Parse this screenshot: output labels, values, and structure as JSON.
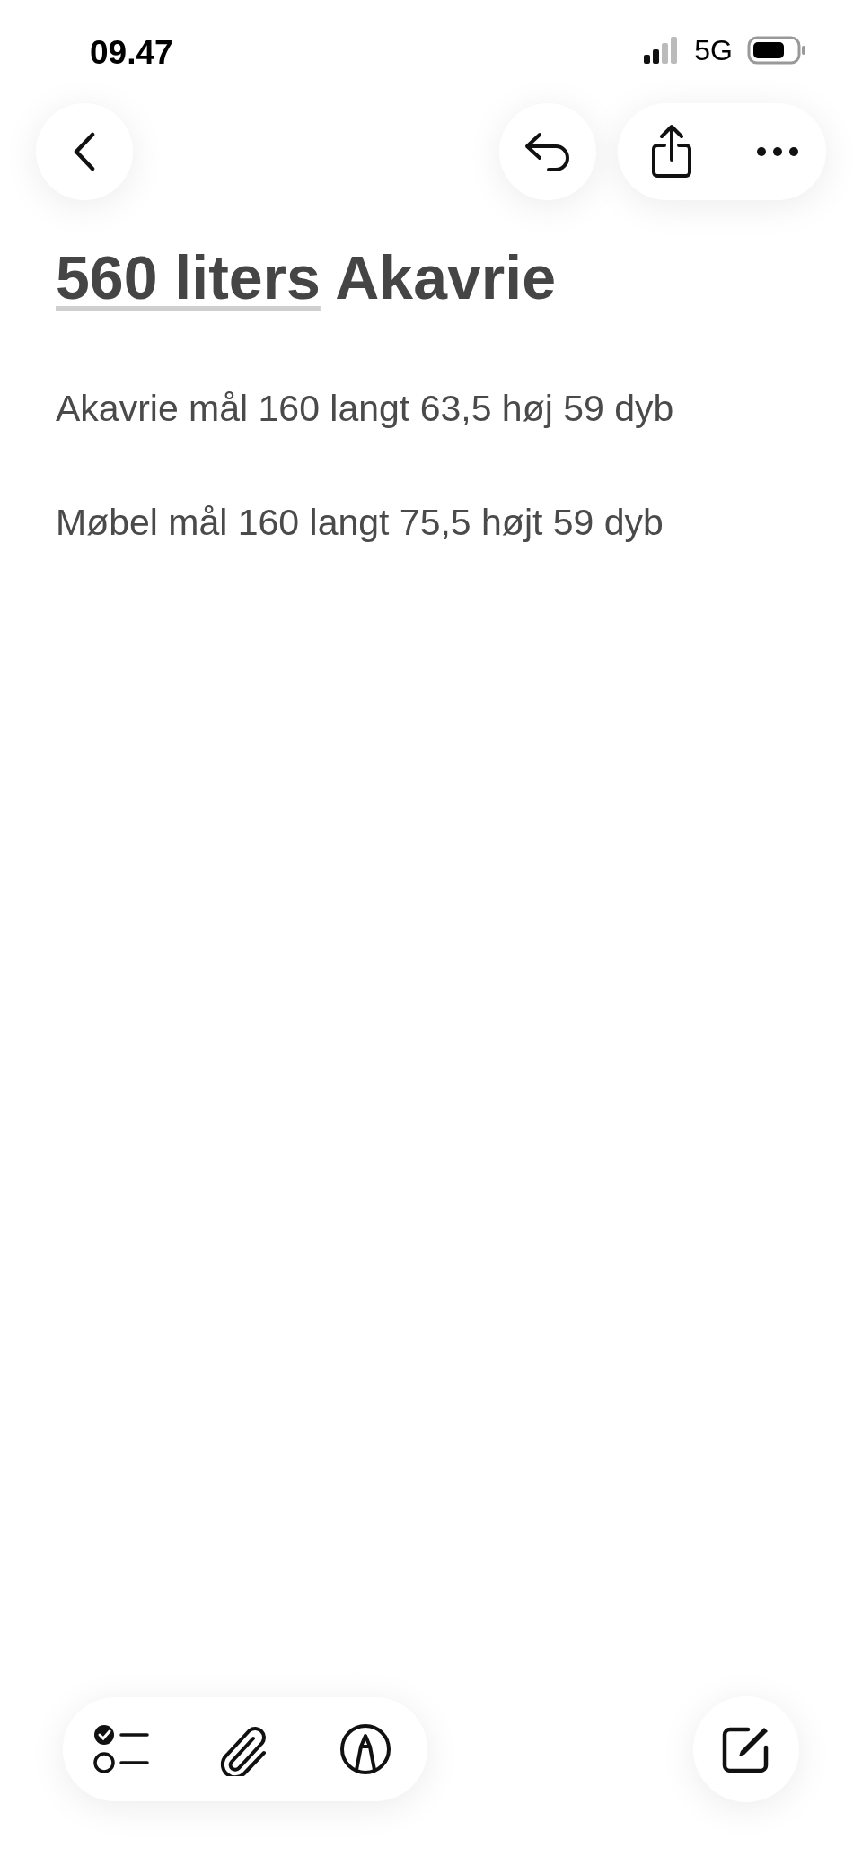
{
  "status_bar": {
    "time": "09.47",
    "network": "5G"
  },
  "toolbar": {
    "buttons": [
      {
        "kind": "back"
      },
      {
        "kind": "undo"
      }
    ],
    "menu": [
      {
        "kind": "share"
      },
      {
        "kind": "more"
      }
    ]
  },
  "note": {
    "title": [
      {
        "text": "560 liters",
        "underlined": true
      },
      {
        "text": " Akavrie",
        "underlined": false
      }
    ],
    "paragraphs": [
      "Akavrie mål 160 langt 63,5 høj 59 dyb",
      "Møbel mål 160 langt 75,5 højt 59 dyb"
    ]
  },
  "bottom_bar": {
    "tools": [
      {
        "kind": "checklist"
      },
      {
        "kind": "attach"
      },
      {
        "kind": "markup"
      }
    ],
    "compose": {
      "kind": "compose"
    }
  }
}
